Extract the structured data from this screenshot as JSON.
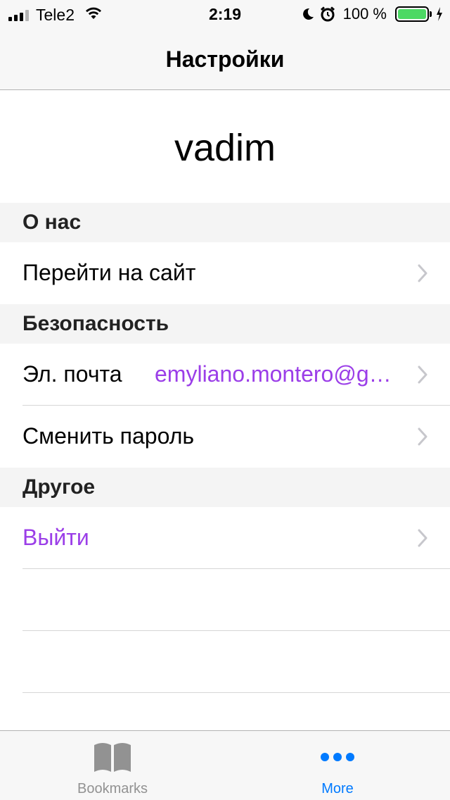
{
  "status_bar": {
    "carrier": "Tele2",
    "time": "2:19",
    "battery_percent": "100 %",
    "battery_level": 1.0,
    "battery_color": "#4cd964",
    "icons": [
      "signal-icon",
      "wifi-icon",
      "moon-icon",
      "alarm-icon",
      "battery-icon",
      "charging-icon"
    ]
  },
  "nav": {
    "title": "Настройки"
  },
  "profile": {
    "name": "vadim"
  },
  "sections": {
    "about": {
      "header": "О нас",
      "rows": [
        {
          "label": "Перейти на сайт"
        }
      ]
    },
    "security": {
      "header": "Безопасность",
      "rows": [
        {
          "label": "Эл. почта",
          "value": "emyliano.montero@gmail.com"
        },
        {
          "label": "Сменить пароль"
        }
      ]
    },
    "other": {
      "header": "Другое",
      "rows": [
        {
          "label": "Выйти"
        }
      ]
    }
  },
  "tab_bar": {
    "tabs": [
      {
        "label": "Bookmarks",
        "icon": "book-icon",
        "active": false
      },
      {
        "label": "More",
        "icon": "more-icon",
        "active": true
      }
    ]
  },
  "colors": {
    "accent": "#9b3ee8",
    "tab_active": "#007aff",
    "tab_inactive": "#929292",
    "section_bg": "#f4f4f4"
  }
}
